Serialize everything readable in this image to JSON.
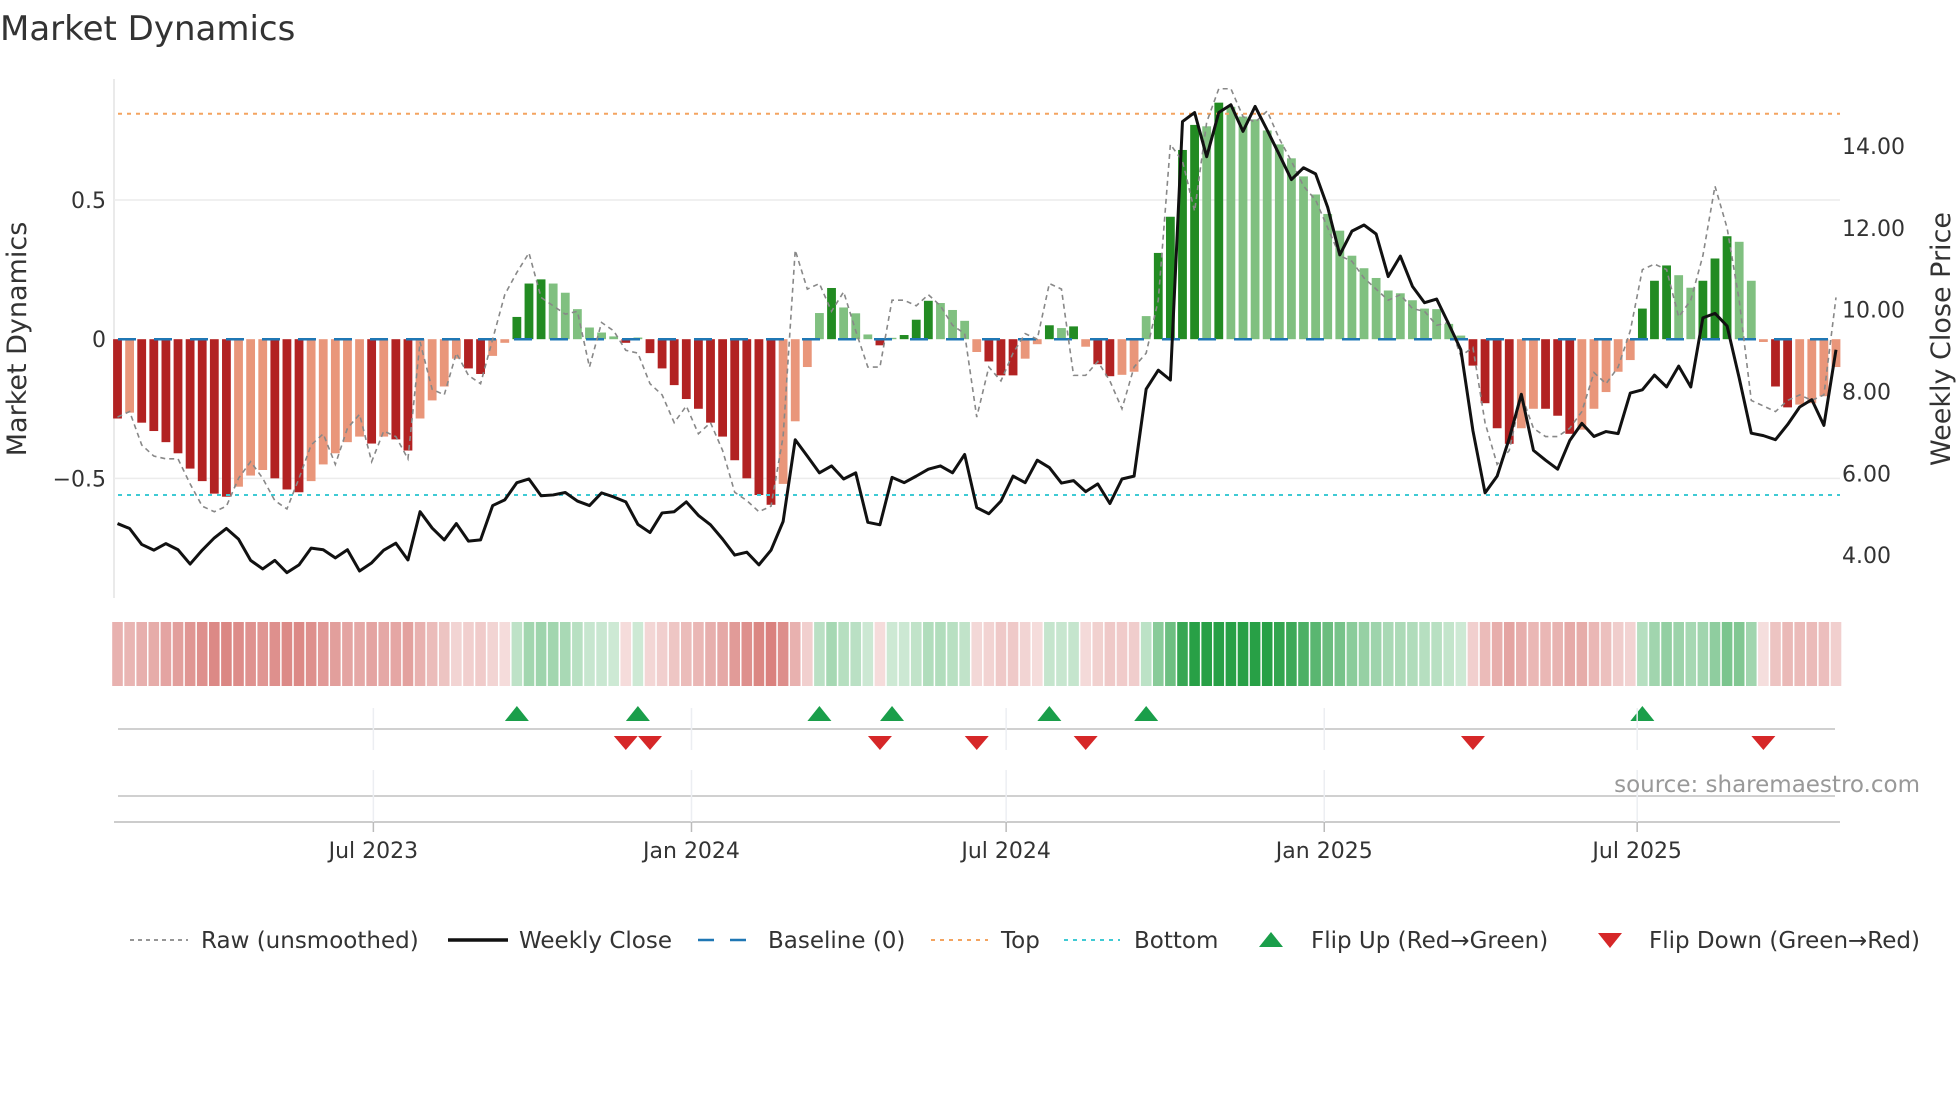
{
  "chart_data": {
    "type": "bar",
    "title": "Market Dynamics",
    "ylabel_left": "Market Dynamics",
    "ylabel_right": "Weekly Close Price",
    "start_date": "2023-02-03",
    "frequency": "weekly",
    "ylim_left": [
      -0.93,
      0.935
    ],
    "ylim_right": [
      2.95,
      15.64
    ],
    "baseline": 0,
    "top": 0.81,
    "bottom": -0.56,
    "yticks_left": [
      {
        "value": 0.5,
        "label": "0.5"
      },
      {
        "value": 0,
        "label": "0"
      },
      {
        "value": -0.5,
        "label": "−0.5"
      }
    ],
    "yticks_right": [
      {
        "value": 14,
        "label": "14.00"
      },
      {
        "value": 12,
        "label": "12.00"
      },
      {
        "value": 10,
        "label": "10.00"
      },
      {
        "value": 8,
        "label": "8.00"
      },
      {
        "value": 6,
        "label": "6.00"
      },
      {
        "value": 4,
        "label": "4.00"
      }
    ],
    "xticks": [
      {
        "date": "2023-07-01",
        "label": "Jul 2023"
      },
      {
        "date": "2024-01-01",
        "label": "Jan 2024"
      },
      {
        "date": "2024-07-01",
        "label": "Jul 2024"
      },
      {
        "date": "2025-01-01",
        "label": "Jan 2025"
      },
      {
        "date": "2025-07-01",
        "label": "Jul 2025"
      }
    ],
    "dynamics": [
      -0.285,
      -0.264,
      -0.3,
      -0.33,
      -0.37,
      -0.41,
      -0.465,
      -0.51,
      -0.555,
      -0.566,
      -0.53,
      -0.49,
      -0.47,
      -0.5,
      -0.54,
      -0.55,
      -0.51,
      -0.45,
      -0.41,
      -0.37,
      -0.35,
      -0.375,
      -0.35,
      -0.36,
      -0.4,
      -0.285,
      -0.22,
      -0.17,
      -0.07,
      -0.105,
      -0.125,
      -0.06,
      -0.013,
      0.08,
      0.2,
      0.215,
      0.2,
      0.167,
      0.108,
      0.042,
      0.024,
      0.01,
      -0.013,
      0.006,
      -0.05,
      -0.105,
      -0.165,
      -0.215,
      -0.25,
      -0.3,
      -0.35,
      -0.435,
      -0.5,
      -0.56,
      -0.595,
      -0.52,
      -0.295,
      -0.1,
      0.094,
      0.184,
      0.114,
      0.093,
      0.017,
      -0.022,
      0.005,
      0.015,
      0.07,
      0.138,
      0.13,
      0.105,
      0.066,
      -0.046,
      -0.08,
      -0.13,
      -0.13,
      -0.07,
      -0.018,
      0.05,
      0.04,
      0.046,
      -0.027,
      -0.09,
      -0.133,
      -0.128,
      -0.117,
      0.083,
      0.31,
      0.44,
      0.68,
      0.77,
      0.765,
      0.85,
      0.835,
      0.8,
      0.79,
      0.75,
      0.7,
      0.65,
      0.585,
      0.52,
      0.45,
      0.39,
      0.3,
      0.255,
      0.22,
      0.175,
      0.165,
      0.14,
      0.11,
      0.108,
      0.055,
      0.013,
      -0.095,
      -0.23,
      -0.32,
      -0.376,
      -0.32,
      -0.25,
      -0.25,
      -0.275,
      -0.34,
      -0.325,
      -0.25,
      -0.19,
      -0.117,
      -0.075,
      0.11,
      0.21,
      0.265,
      0.23,
      0.185,
      0.21,
      0.29,
      0.37,
      0.35,
      0.21,
      -0.01,
      -0.17,
      -0.245,
      -0.235,
      -0.23,
      -0.205,
      -0.1
    ],
    "raw": [
      -0.28,
      -0.26,
      -0.38,
      -0.42,
      -0.43,
      -0.43,
      -0.52,
      -0.6,
      -0.62,
      -0.6,
      -0.5,
      -0.44,
      -0.5,
      -0.58,
      -0.61,
      -0.5,
      -0.38,
      -0.34,
      -0.45,
      -0.32,
      -0.27,
      -0.44,
      -0.33,
      -0.35,
      -0.43,
      -0.01,
      -0.18,
      -0.2,
      -0.05,
      -0.13,
      -0.16,
      0.0,
      0.16,
      0.24,
      0.31,
      0.15,
      0.12,
      0.09,
      0.1,
      -0.1,
      0.06,
      0.03,
      -0.04,
      -0.05,
      -0.16,
      -0.2,
      -0.3,
      -0.24,
      -0.34,
      -0.3,
      -0.4,
      -0.55,
      -0.58,
      -0.62,
      -0.6,
      -0.35,
      0.32,
      0.18,
      0.2,
      0.1,
      0.17,
      0.03,
      -0.1,
      -0.1,
      0.14,
      0.14,
      0.12,
      0.16,
      0.12,
      0.05,
      0.02,
      -0.28,
      -0.1,
      -0.15,
      -0.05,
      0.02,
      0.0,
      0.2,
      0.18,
      -0.13,
      -0.13,
      -0.08,
      -0.15,
      -0.25,
      -0.1,
      -0.05,
      0.14,
      0.7,
      0.64,
      0.46,
      0.78,
      0.9,
      0.9,
      0.8,
      0.78,
      0.82,
      0.72,
      0.64,
      0.55,
      0.5,
      0.4,
      0.3,
      0.28,
      0.22,
      0.18,
      0.14,
      0.16,
      0.11,
      0.1,
      0.05,
      0.06,
      -0.06,
      -0.03,
      -0.3,
      -0.45,
      -0.4,
      -0.2,
      -0.32,
      -0.35,
      -0.35,
      -0.32,
      -0.26,
      -0.12,
      -0.16,
      -0.1,
      0.03,
      0.25,
      0.27,
      0.25,
      0.08,
      0.14,
      0.3,
      0.55,
      0.4,
      0.14,
      -0.22,
      -0.24,
      -0.26,
      -0.22,
      -0.2,
      -0.22,
      -0.2,
      0.15
    ],
    "close": [
      4.77,
      4.65,
      4.26,
      4.12,
      4.28,
      4.13,
      3.78,
      4.12,
      4.42,
      4.65,
      4.39,
      3.87,
      3.66,
      3.87,
      3.57,
      3.76,
      4.17,
      4.13,
      3.93,
      4.13,
      3.61,
      3.81,
      4.12,
      4.29,
      3.88,
      5.06,
      4.66,
      4.37,
      4.77,
      4.34,
      4.37,
      5.21,
      5.35,
      5.77,
      5.86,
      5.45,
      5.47,
      5.53,
      5.32,
      5.21,
      5.52,
      5.42,
      5.3,
      4.75,
      4.55,
      5.03,
      5.06,
      5.3,
      4.97,
      4.74,
      4.39,
      4.0,
      4.07,
      3.76,
      4.12,
      4.82,
      6.82,
      6.42,
      6.01,
      6.18,
      5.86,
      6.01,
      4.8,
      4.74,
      5.9,
      5.77,
      5.93,
      6.1,
      6.18,
      6.01,
      6.46,
      5.16,
      5.01,
      5.32,
      5.93,
      5.77,
      6.32,
      6.14,
      5.76,
      5.82,
      5.55,
      5.74,
      5.26,
      5.86,
      5.93,
      8.06,
      8.52,
      8.28,
      14.6,
      14.82,
      13.74,
      14.82,
      15.01,
      14.36,
      14.97,
      14.39,
      13.79,
      13.18,
      13.47,
      13.32,
      12.5,
      11.34,
      11.92,
      12.07,
      11.85,
      10.81,
      11.31,
      10.57,
      10.17,
      10.26,
      9.65,
      9.02,
      7.04,
      5.52,
      5.93,
      6.85,
      7.93,
      6.56,
      6.32,
      6.1,
      6.8,
      7.22,
      6.9,
      7.02,
      6.97,
      7.96,
      8.04,
      8.4,
      8.11,
      8.62,
      8.11,
      9.8,
      9.91,
      9.6,
      8.33,
      6.98,
      6.92,
      6.82,
      7.19,
      7.62,
      7.8,
      7.17,
      9.02
    ],
    "legend": [
      {
        "key": "raw",
        "label": "Raw (unsmoothed)"
      },
      {
        "key": "close",
        "label": "Weekly Close"
      },
      {
        "key": "baseline",
        "label": "Baseline (0)"
      },
      {
        "key": "top",
        "label": "Top"
      },
      {
        "key": "bottom",
        "label": "Bottom"
      },
      {
        "key": "flip_up",
        "label": "Flip Up (Red→Green)"
      },
      {
        "key": "flip_down",
        "label": "Flip Down (Green→Red)"
      }
    ],
    "legend_position": "bottom",
    "source": "source: sharemaestro.com"
  },
  "colors": {
    "dark_red": "#b22222",
    "light_red": "#e9967a",
    "dark_green": "#228b22",
    "light_green": "#80c080",
    "baseline": "#1f77b4",
    "top": "#f4a460",
    "bottom": "#3fcad4",
    "flip_up": "#1a9e4a",
    "flip_down": "#d62728",
    "close": "#111111",
    "raw": "#888888"
  }
}
